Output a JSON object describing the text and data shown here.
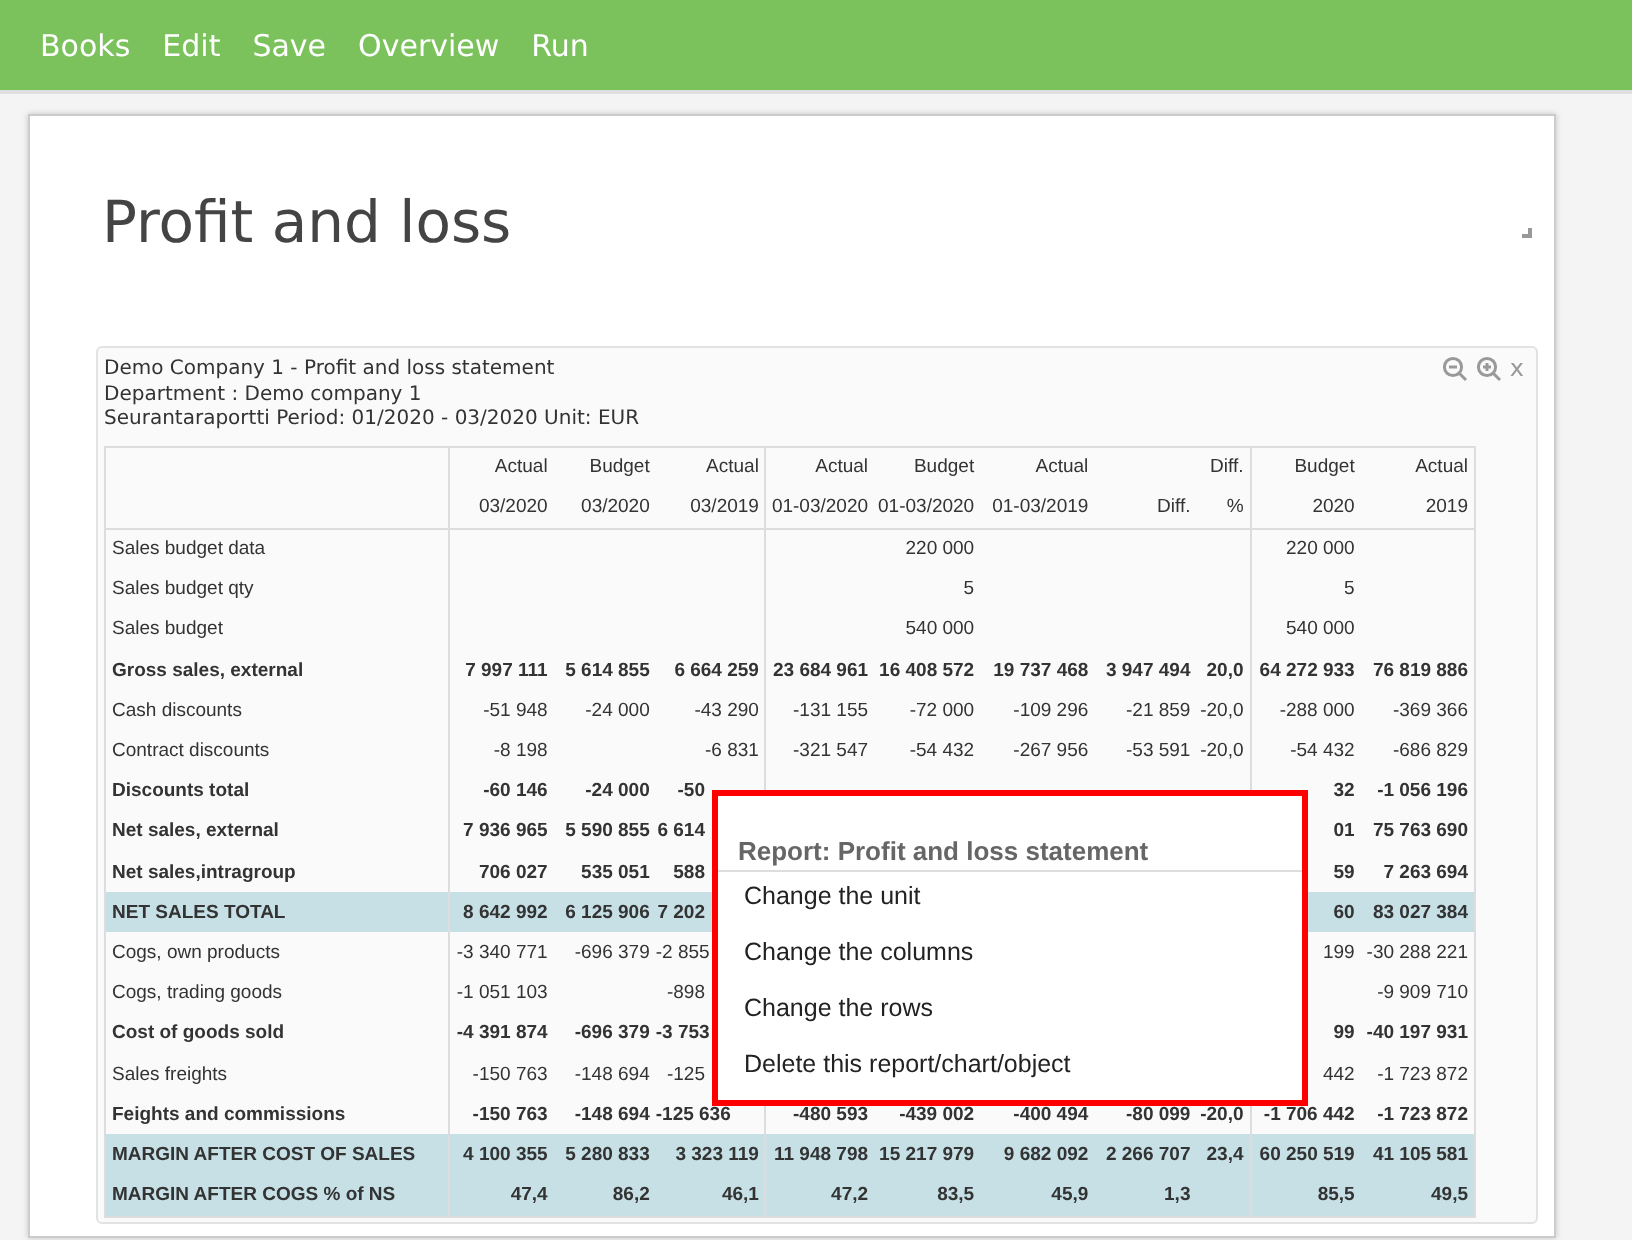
{
  "menu": [
    "Books",
    "Edit",
    "Save",
    "Overview",
    "Run"
  ],
  "page_title": "Profit and loss",
  "report": {
    "header_lines": [
      "Demo Company 1 - Profit and loss statement",
      "Department : Demo company 1",
      "Seurantaraportti Period: 01/2020 - 03/2020 Unit: EUR"
    ],
    "close": "x",
    "columns": [
      {
        "line1": "Actual",
        "line2": "03/2020"
      },
      {
        "line1": "Budget",
        "line2": "03/2020"
      },
      {
        "line1": "Actual",
        "line2": "03/2019"
      },
      {
        "line1": "Actual",
        "line2": "01-03/2020"
      },
      {
        "line1": "Budget",
        "line2": "01-03/2020"
      },
      {
        "line1": "Actual",
        "line2": "01-03/2019"
      },
      {
        "line2": "Diff."
      },
      {
        "line1": "Diff.",
        "line2": "%"
      },
      {
        "line1": "Budget",
        "line2": "2020"
      },
      {
        "line1": "Actual",
        "line2": "2019"
      }
    ],
    "rows": [
      {
        "label": "Sales budget data",
        "kind": "normal",
        "values": {
          "budget_ytd": "220 000",
          "budget_year": "220 000"
        }
      },
      {
        "label": "Sales budget qty",
        "kind": "normal",
        "values": {
          "budget_ytd": "5",
          "budget_year": "5"
        }
      },
      {
        "label": "Sales budget",
        "kind": "normal",
        "values": {
          "budget_ytd": "540 000",
          "budget_year": "540 000"
        }
      },
      {
        "label": "Gross sales, external",
        "kind": "bold",
        "values": {
          "actual_month": "7 997 111",
          "budget_month": "5 614 855",
          "actual_month_prev": "6 664 259",
          "actual_ytd": "23 684 961",
          "budget_ytd": "16 408 572",
          "actual_ytd_prev": "19 737 468",
          "diff": "3 947 494",
          "diff_pct": "20,0",
          "budget_year": "64 272 933",
          "actual_year_prev": "76 819 886"
        }
      },
      {
        "label": "Cash discounts",
        "kind": "normal",
        "values": {
          "actual_month": "-51 948",
          "budget_month": "-24 000",
          "actual_month_prev": "-43 290",
          "actual_ytd": "-131 155",
          "budget_ytd": "-72 000",
          "actual_ytd_prev": "-109 296",
          "diff": "-21 859",
          "diff_pct": "-20,0",
          "budget_year": "-288 000",
          "actual_year_prev": "-369 366"
        }
      },
      {
        "label": "Contract discounts",
        "kind": "normal",
        "values": {
          "actual_month": "-8 198",
          "actual_month_prev": "-6 831",
          "actual_ytd": "-321 547",
          "budget_ytd": "-54 432",
          "actual_ytd_prev": "-267 956",
          "diff": "-53 591",
          "diff_pct": "-20,0",
          "budget_year": "-54 432",
          "actual_year_prev": "-686 829"
        }
      },
      {
        "label": "Discounts total",
        "kind": "bold",
        "values": {
          "actual_month": "-60 146",
          "budget_month": "-24 000",
          "actual_month_prev": "-50",
          "budget_year": "32",
          "actual_year_prev": "-1 056 196"
        }
      },
      {
        "label": "Net sales, external",
        "kind": "bold",
        "values": {
          "actual_month": "7 936 965",
          "budget_month": "5 590 855",
          "actual_month_prev": "6 614",
          "budget_year": "01",
          "actual_year_prev": "75 763 690"
        }
      },
      {
        "label": "Net sales,intragroup",
        "kind": "bold",
        "values": {
          "actual_month": "706 027",
          "budget_month": "535 051",
          "actual_month_prev": "588",
          "budget_year": "59",
          "actual_year_prev": "7 263 694"
        }
      },
      {
        "label": "NET SALES TOTAL",
        "kind": "total",
        "values": {
          "actual_month": "8 642 992",
          "budget_month": "6 125 906",
          "actual_month_prev": "7 202",
          "budget_year": "60",
          "actual_year_prev": "83 027 384"
        }
      },
      {
        "label": "Cogs, own products",
        "kind": "normal",
        "values": {
          "actual_month": "-3 340 771",
          "budget_month": "-696 379",
          "actual_month_prev": "-2 855",
          "budget_year": "199",
          "actual_year_prev": "-30 288 221"
        }
      },
      {
        "label": "Cogs, trading goods",
        "kind": "normal",
        "values": {
          "actual_month": "-1 051 103",
          "actual_month_prev": "-898",
          "actual_year_prev": "-9 909 710"
        }
      },
      {
        "label": "Cost of goods sold",
        "kind": "bold",
        "values": {
          "actual_month": "-4 391 874",
          "budget_month": "-696 379",
          "actual_month_prev": "-3 753",
          "budget_year": "99",
          "actual_year_prev": "-40 197 931"
        }
      },
      {
        "label": "Sales freights",
        "kind": "normal",
        "values": {
          "actual_month": "-150 763",
          "budget_month": "-148 694",
          "actual_month_prev": "-125",
          "budget_year": "442",
          "actual_year_prev": "-1 723 872"
        }
      },
      {
        "label": "Feights and commissions",
        "kind": "bold",
        "values": {
          "actual_month": "-150 763",
          "budget_month": "-148 694",
          "actual_month_prev": "-125 636",
          "actual_ytd": "-480 593",
          "budget_ytd": "-439 002",
          "actual_ytd_prev": "-400 494",
          "diff": "-80 099",
          "diff_pct": "-20,0",
          "budget_year": "-1 706 442",
          "actual_year_prev": "-1 723 872"
        }
      },
      {
        "label": "MARGIN AFTER COST OF SALES",
        "kind": "total",
        "values": {
          "actual_month": "4 100 355",
          "budget_month": "5 280 833",
          "actual_month_prev": "3 323 119",
          "actual_ytd": "11 948 798",
          "budget_ytd": "15 217 979",
          "actual_ytd_prev": "9 682 092",
          "diff": "2 266 707",
          "diff_pct": "23,4",
          "budget_year": "60 250 519",
          "actual_year_prev": "41 105 581"
        }
      },
      {
        "label": "MARGIN AFTER COGS % of NS",
        "kind": "total",
        "values": {
          "actual_month": "47,4",
          "budget_month": "86,2",
          "actual_month_prev": "46,1",
          "actual_ytd": "47,2",
          "budget_ytd": "83,5",
          "actual_ytd_prev": "45,9",
          "diff": "1,3",
          "budget_year": "85,5",
          "actual_year_prev": "49,5"
        }
      }
    ]
  },
  "context_menu": {
    "title": "Report: Profit and loss statement",
    "items": [
      "Change the unit",
      "Change the columns",
      "Change the rows",
      "Delete this report/chart/object"
    ]
  }
}
